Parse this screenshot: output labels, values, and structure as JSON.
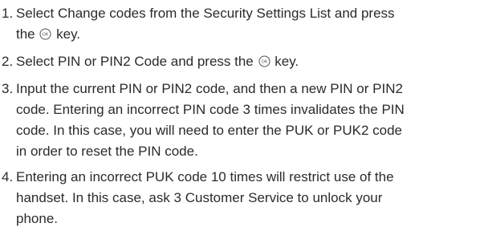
{
  "instructions": {
    "step1": {
      "number": "1.",
      "line1": "Select Change codes from the Security Settings List and press",
      "line2_pre": "the",
      "line2_post": "key.",
      "key_icon": "ok-key-icon"
    },
    "step2": {
      "number": "2.",
      "pre": "Select PIN or PIN2 Code and press the",
      "post": "key.",
      "key_icon": "ok-key-icon"
    },
    "step3": {
      "number": "3.",
      "lines": [
        "Input the current PIN or PIN2 code, and then a new PIN or PIN2",
        "code. Entering an incorrect PIN code 3 times invalidates the PIN",
        "code. In this case, you will need to enter the PUK or PUK2 code",
        "in order to reset the PIN code."
      ]
    },
    "step4": {
      "number": "4.",
      "lines": [
        "Entering an incorrect PUK code 10 times will restrict use of the",
        "handset. In this case, ask 3 Customer Service to unlock your",
        "phone."
      ]
    }
  },
  "colors": {
    "text": "#2b2b2b",
    "icon_stroke": "#555555"
  }
}
